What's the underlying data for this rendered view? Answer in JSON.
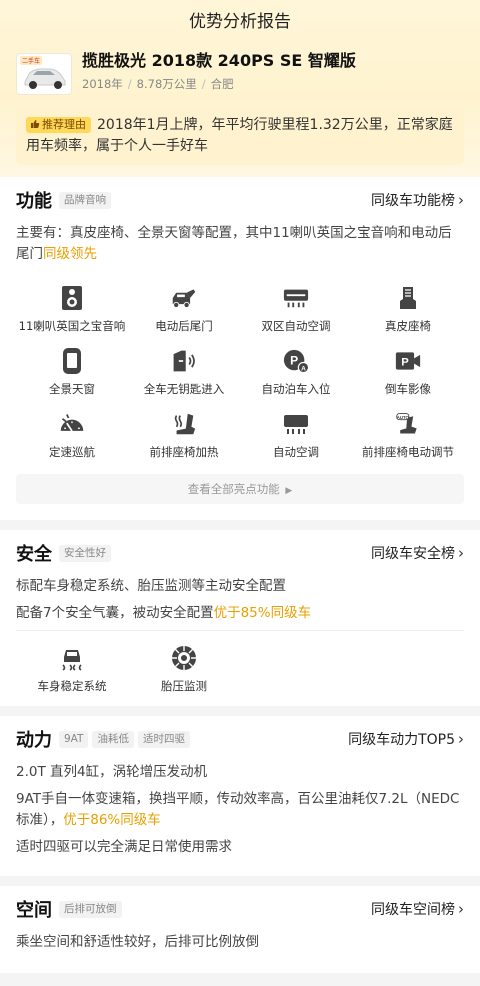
{
  "nav": {
    "title": "优势分析报告"
  },
  "car": {
    "thumb_tag": "二手车",
    "name": "揽胜极光 2018款 240PS SE 智耀版",
    "year": "2018年",
    "mileage": "8.78万公里",
    "city": "合肥"
  },
  "reason": {
    "tag": "推荐理由",
    "text": "2018年1月上牌，年平均行驶里程1.32万公里，正常家庭用车频率，属于个人一手好车"
  },
  "function": {
    "title": "功能",
    "chip": "品牌音响",
    "rank": "同级车功能榜",
    "desc_main": "主要有：真皮座椅、全景天窗等配置，其中11喇叭英国之宝音响和电动后尾门",
    "desc_hl": "同级领先",
    "items": [
      {
        "label": "11喇叭英国之宝音响",
        "icon": "speaker-icon"
      },
      {
        "label": "电动后尾门",
        "icon": "tailgate-icon"
      },
      {
        "label": "双区自动空调",
        "icon": "ac-dual-icon"
      },
      {
        "label": "真皮座椅",
        "icon": "leather-seat-icon"
      },
      {
        "label": "全景天窗",
        "icon": "sunroof-icon"
      },
      {
        "label": "全车无钥匙进入",
        "icon": "keyless-icon"
      },
      {
        "label": "自动泊车入位",
        "icon": "auto-parking-icon"
      },
      {
        "label": "倒车影像",
        "icon": "reverse-camera-icon"
      },
      {
        "label": "定速巡航",
        "icon": "cruise-icon"
      },
      {
        "label": "前排座椅加热",
        "icon": "seat-heat-icon"
      },
      {
        "label": "自动空调",
        "icon": "auto-ac-icon"
      },
      {
        "label": "前排座椅电动调节",
        "icon": "seat-power-icon"
      }
    ],
    "see_all": "查看全部亮点功能"
  },
  "safety": {
    "title": "安全",
    "chip": "安全性好",
    "rank": "同级车安全榜",
    "line1": "标配车身稳定系统、胎压监测等主动安全配置",
    "line2_main": "配备7个安全气囊，被动安全配置",
    "line2_hl": "优于85%同级车",
    "items": [
      {
        "label": "车身稳定系统",
        "icon": "stability-icon"
      },
      {
        "label": "胎压监测",
        "icon": "tire-pressure-icon"
      }
    ]
  },
  "power": {
    "title": "动力",
    "chips": [
      "9AT",
      "油耗低",
      "适时四驱"
    ],
    "rank": "同级车动力TOP5",
    "line1": "2.0T 直列4缸，涡轮增压发动机",
    "line2_main": "9AT手自一体变速箱，换挡平顺，传动效率高，百公里油耗仅7.2L（NEDC标准），",
    "line2_hl": "优于86%同级车",
    "line3": "适时四驱可以完全满足日常使用需求"
  },
  "space": {
    "title": "空间",
    "chip": "后排可放倒",
    "rank": "同级车空间榜",
    "line1": "乘坐空间和舒适性较好，后排可比例放倒"
  },
  "colors": {
    "accent": "#e8a000",
    "tag_bg": "#ffd85a",
    "hero_bg": "#fff3cf"
  }
}
